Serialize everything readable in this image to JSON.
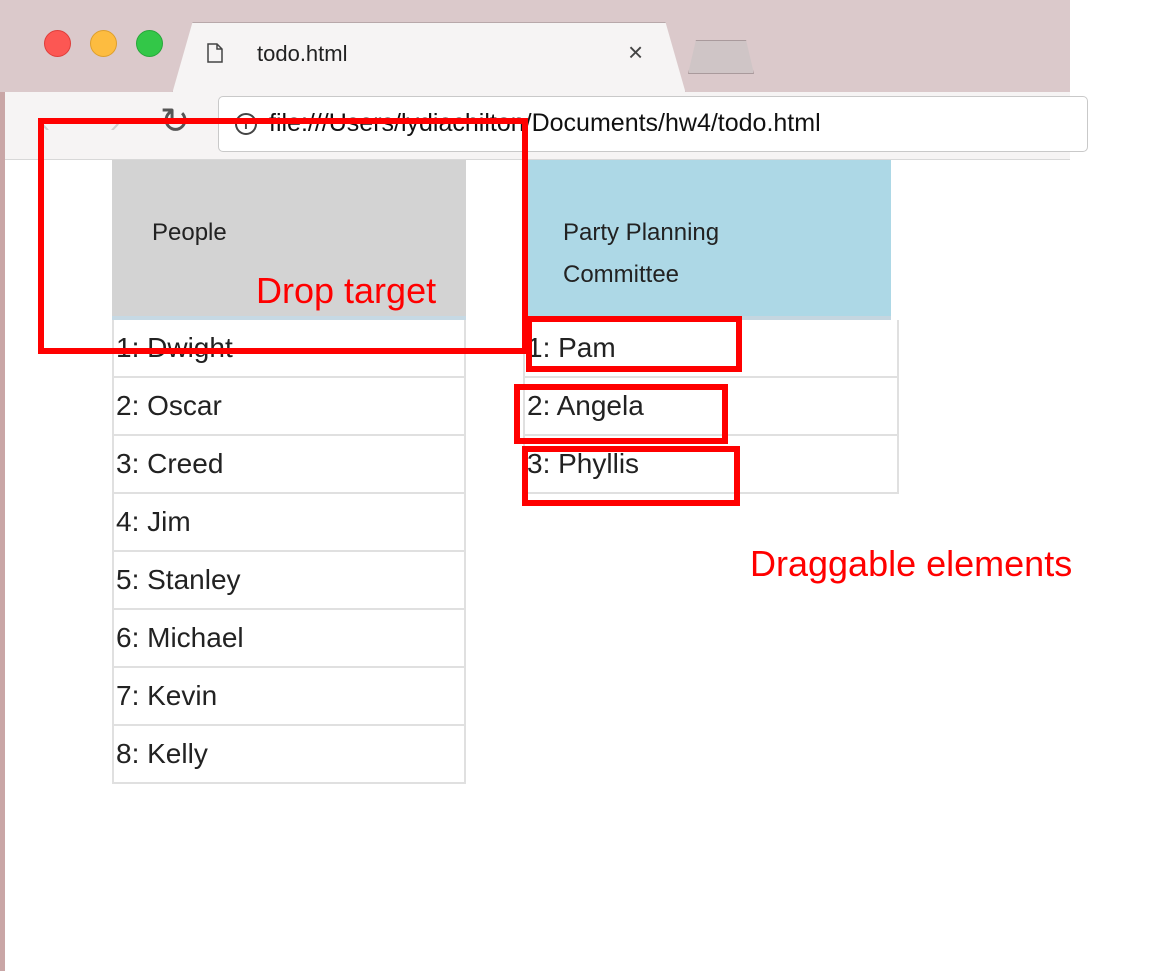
{
  "browser": {
    "tab_title": "todo.html",
    "tab_close": "×",
    "url": "file:///Users/lydiachilton/Documents/hw4/todo.html",
    "icons": [
      "document-icon",
      "close-icon",
      "back-arrow-icon",
      "forward-arrow-icon",
      "reload-icon",
      "info-icon"
    ]
  },
  "columns": {
    "people": {
      "title": "People",
      "items": [
        "1: Dwight",
        "2: Oscar",
        "3: Creed",
        "4: Jim",
        "5: Stanley",
        "6: Michael",
        "7: Kevin",
        "8: Kelly"
      ]
    },
    "committee": {
      "title_line1": "Party Planning",
      "title_line2": "Committee",
      "items": [
        "1: Pam",
        "2: Angela",
        "3: Phyllis"
      ]
    }
  },
  "annotations": {
    "drop_target": "Drop target",
    "draggable": "Draggable elements"
  },
  "colors": {
    "people_header": "#d3d3d3",
    "committee_header": "#add8e6",
    "annotation": "#ff0000"
  }
}
